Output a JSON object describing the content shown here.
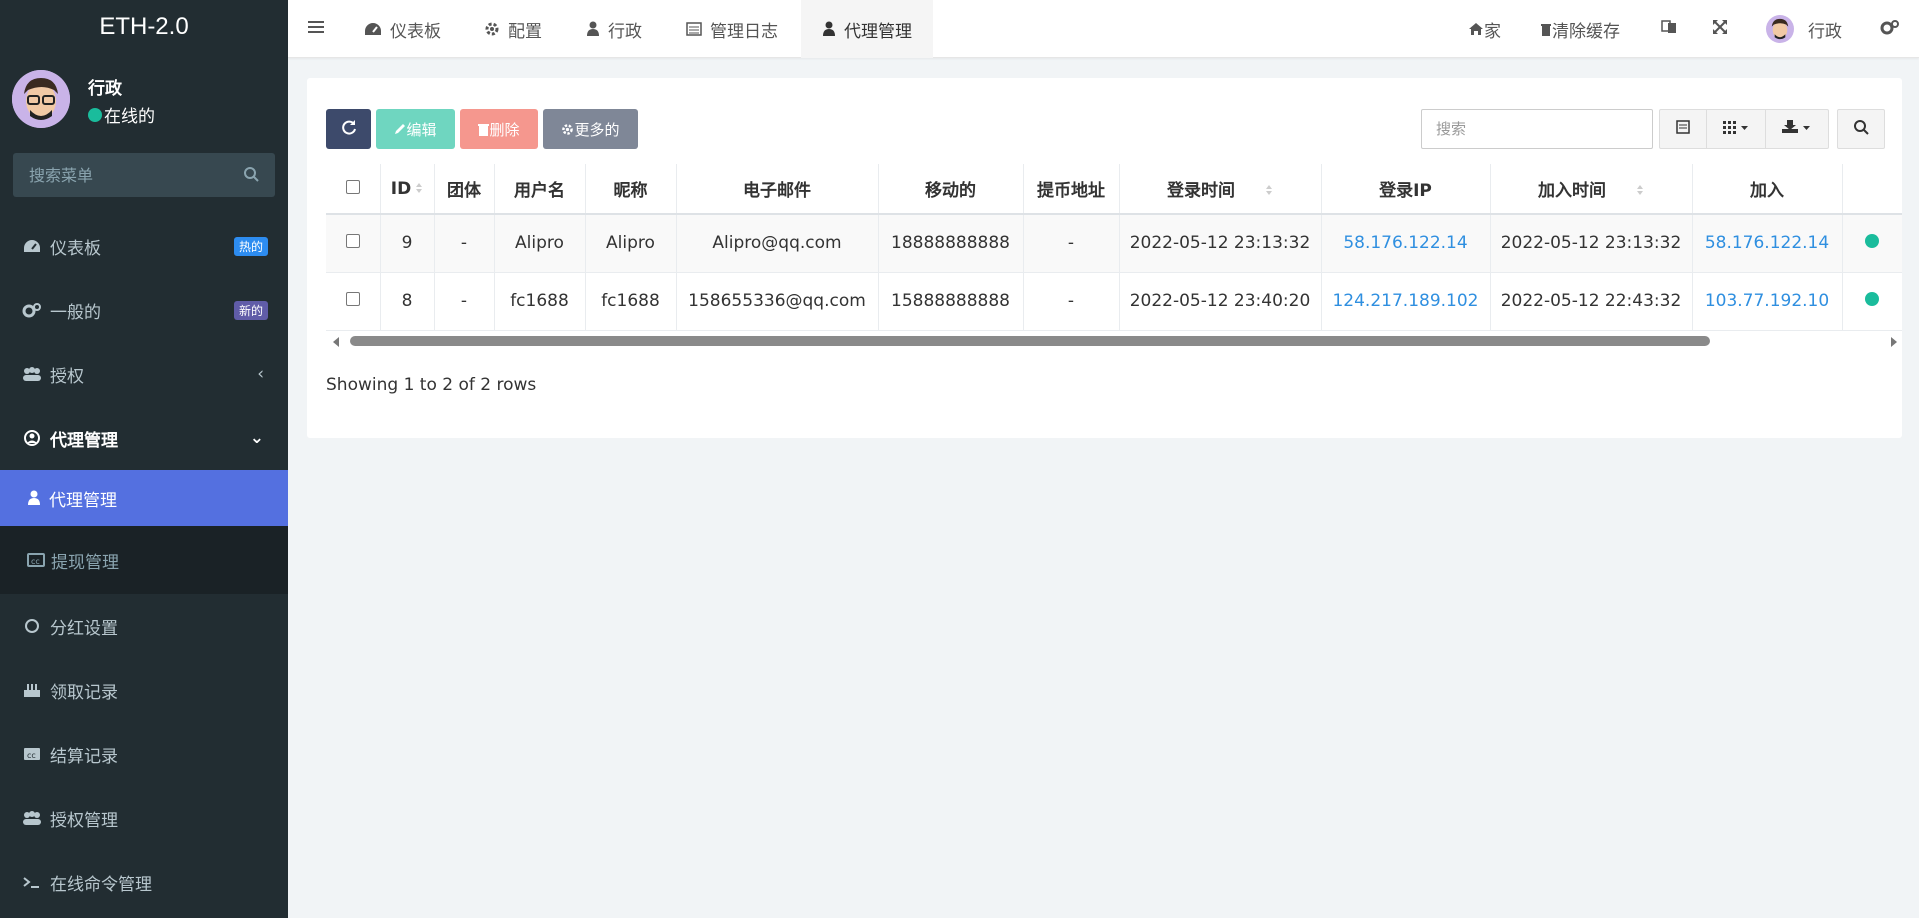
{
  "brand": "ETH-2.0",
  "user": {
    "name": "行政",
    "status": "在线的"
  },
  "sidebar": {
    "search_placeholder": "搜索菜单",
    "items": [
      {
        "label": "仪表板",
        "icon": "dashboard-icon",
        "badge": "热的"
      },
      {
        "label": "一般的",
        "icon": "cogs-icon",
        "badge": "新的"
      },
      {
        "label": "授权",
        "icon": "users-icon",
        "chevron": "‹"
      },
      {
        "label": "代理管理",
        "icon": "user-circle-icon",
        "chevron": "⌄"
      }
    ],
    "submenu": [
      {
        "label": "代理管理",
        "icon": "user-icon"
      },
      {
        "label": "提现管理",
        "icon": "cc-icon"
      }
    ],
    "items2": [
      {
        "label": "分红设置",
        "icon": "circle-icon"
      },
      {
        "label": "领取记录",
        "icon": "birthday-icon"
      },
      {
        "label": "结算记录",
        "icon": "cc-icon"
      },
      {
        "label": "授权管理",
        "icon": "users-icon"
      },
      {
        "label": "在线命令管理",
        "icon": "terminal-icon"
      }
    ]
  },
  "topbar": {
    "tabs": [
      {
        "label": "仪表板",
        "icon": "dashboard-icon"
      },
      {
        "label": "配置",
        "icon": "gear-icon"
      },
      {
        "label": "行政",
        "icon": "user-icon"
      },
      {
        "label": "管理日志",
        "icon": "list-icon"
      },
      {
        "label": "代理管理",
        "icon": "user-icon"
      }
    ],
    "home": "家",
    "clear_cache": "清除缓存",
    "admin": "行政"
  },
  "toolbar": {
    "edit": "编辑",
    "delete": "删除",
    "more": "更多的",
    "search_placeholder": "搜索"
  },
  "table": {
    "columns": [
      "ID",
      "团体",
      "用户名",
      "昵称",
      "电子邮件",
      "移动的",
      "提币地址",
      "登录时间",
      "登录IP",
      "加入时间",
      "加入"
    ],
    "rows": [
      [
        "9",
        "-",
        "Alipro",
        "Alipro",
        "Alipro@qq.com",
        "18888888888",
        "-",
        "2022-05-12 23:13:32",
        "58.176.122.14",
        "2022-05-12 23:13:32",
        "58.176.122.14"
      ],
      [
        "8",
        "-",
        "fc1688",
        "fc1688",
        "158655336@qq.com",
        "15888888888",
        "-",
        "2022-05-12 23:40:20",
        "124.217.189.102",
        "2022-05-12 22:43:32",
        "103.77.192.10"
      ]
    ]
  },
  "footer": "Showing 1 to 2 of 2 rows",
  "colors": {
    "accent": "#5470e0",
    "refresh": "#3d4a6b",
    "edit": "#6fd6c0",
    "delete": "#f5978e",
    "more": "#7f8797"
  }
}
